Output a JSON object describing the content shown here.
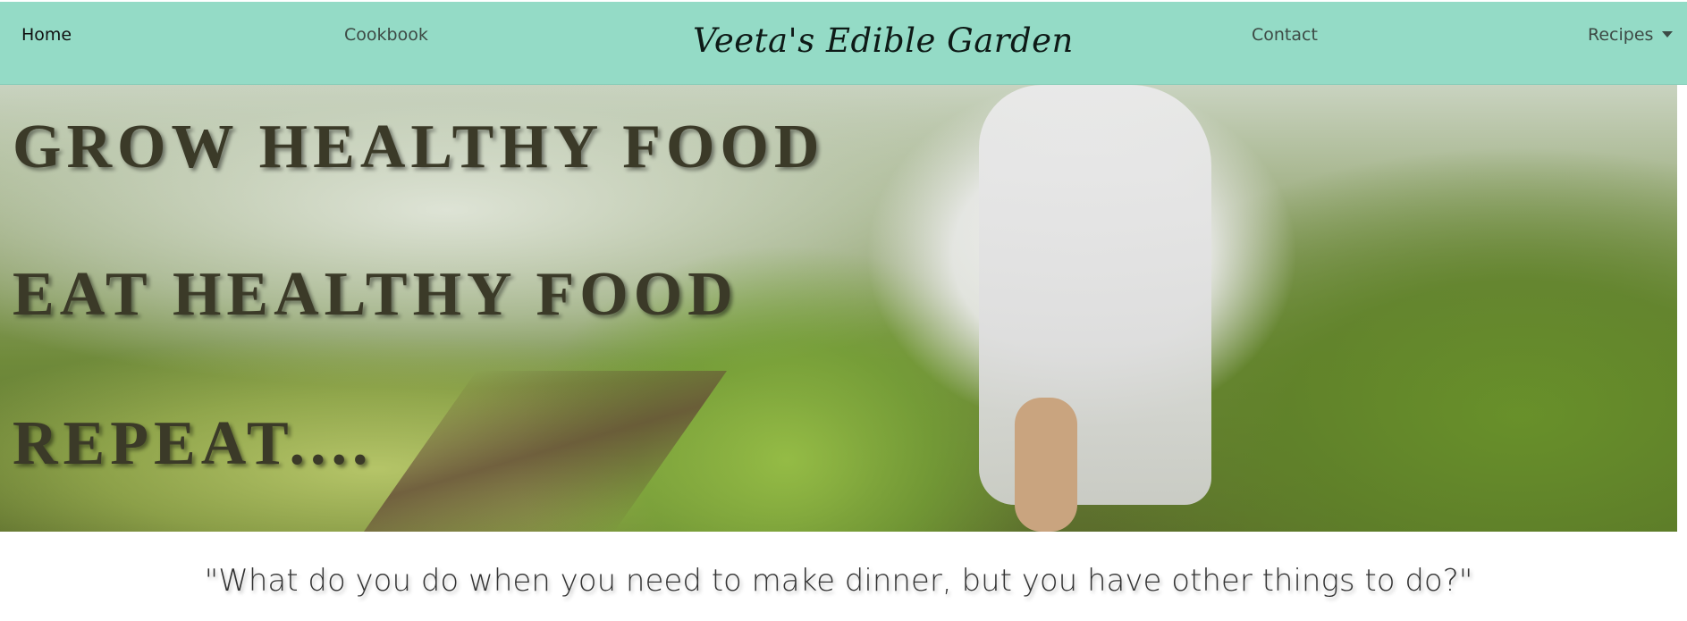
{
  "navbar": {
    "brand": "Veeta's Edible Garden",
    "links": {
      "home": "Home",
      "cookbook": "Cookbook",
      "contact": "Contact",
      "recipes": "Recipes"
    }
  },
  "hero": {
    "lines": [
      "GROW HEALTHY FOOD",
      "EAT HEALTHY FOOD",
      "REPEAT...."
    ]
  },
  "quote": "\"What do you do when you need to make dinner, but you have other things to do?\"",
  "colors": {
    "navbar_bg": "#94dbc6",
    "hero_text": "#3b3a28"
  }
}
